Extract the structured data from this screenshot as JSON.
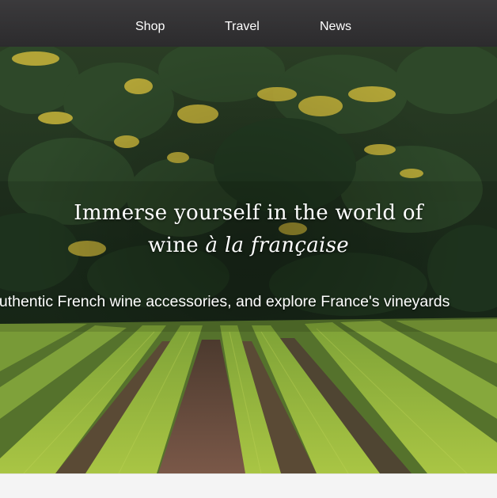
{
  "nav": {
    "items": [
      {
        "label": "Shop"
      },
      {
        "label": "Travel"
      },
      {
        "label": "News"
      }
    ]
  },
  "hero": {
    "title_line1": "Immerse yourself in the world of",
    "title_line2_prefix": "wine ",
    "title_line2_italic": "à la française",
    "tagline": "authentic French wine accessories, and explore France's vineyards",
    "image_description": "vineyard-rows-forest-hillside"
  },
  "colors": {
    "nav_background": "#333235",
    "text": "#ffffff",
    "forest_dark": "#18291a",
    "vine_green": "#8fb43a",
    "broom_yellow": "#d7c53a",
    "soil": "#6b4a3a"
  }
}
